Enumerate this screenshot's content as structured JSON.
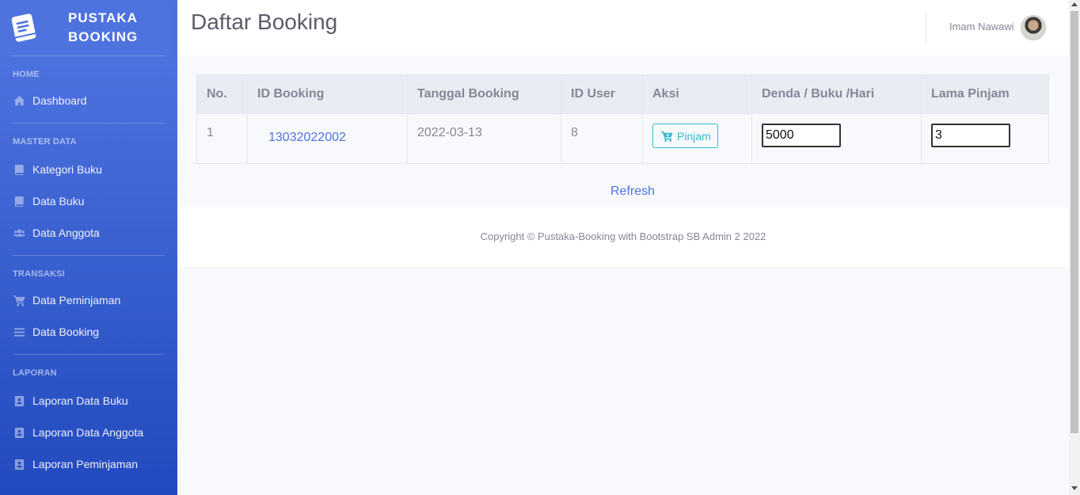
{
  "brand": {
    "line1": "PUSTAKA",
    "line2": "BOOKING",
    "logo_icon": "book-icon"
  },
  "sidebar": {
    "sections": [
      {
        "heading": "HOME",
        "items": [
          {
            "label": "Dashboard",
            "icon": "home-icon"
          }
        ]
      },
      {
        "heading": "MASTER DATA",
        "items": [
          {
            "label": "Kategori Buku",
            "icon": "book-icon"
          },
          {
            "label": "Data Buku",
            "icon": "book-icon"
          },
          {
            "label": "Data Anggota",
            "icon": "users-icon"
          }
        ]
      },
      {
        "heading": "TRANSAKSI",
        "items": [
          {
            "label": "Data Peminjaman",
            "icon": "cart-icon"
          },
          {
            "label": "Data Booking",
            "icon": "list-icon"
          }
        ]
      },
      {
        "heading": "LAPORAN",
        "items": [
          {
            "label": "Laporan Data Buku",
            "icon": "address-book-icon"
          },
          {
            "label": "Laporan Data Anggota",
            "icon": "address-book-icon"
          },
          {
            "label": "Laporan Peminjaman",
            "icon": "address-book-icon"
          }
        ]
      }
    ]
  },
  "topbar": {
    "title": "Daftar Booking",
    "user_name": "Imam Nawawi"
  },
  "table": {
    "headers": [
      "No.",
      "ID Booking",
      "Tanggal Booking",
      "ID User",
      "Aksi",
      "Denda / Buku /Hari",
      "Lama Pinjam"
    ],
    "rows": [
      {
        "no": "1",
        "id_booking": "13032022002",
        "tanggal": "2022-03-13",
        "id_user": "8",
        "aksi_label": "Pinjam",
        "denda": "5000",
        "lama": "3"
      }
    ]
  },
  "refresh_label": "Refresh",
  "footer": {
    "copyright": "Copyright © Pustaka-Booking with Bootstrap SB Admin 2 2022"
  },
  "colors": {
    "primary": "#4e73df",
    "info": "#36b9cc",
    "text_muted": "#858796"
  }
}
